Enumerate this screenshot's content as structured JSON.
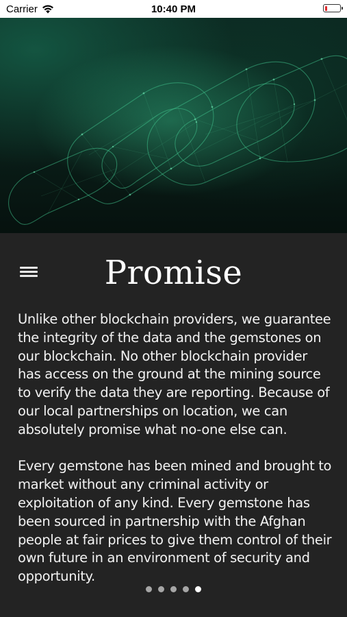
{
  "status_bar": {
    "carrier": "Carrier",
    "time": "10:40 PM",
    "battery_level": 0.1,
    "battery_color": "#e0292b"
  },
  "hero": {
    "image": "blockchain-chain-links",
    "tint_color": "#1a7a5c"
  },
  "menu": {
    "icon": "hamburger-menu-icon"
  },
  "page": {
    "title": "Promise",
    "paragraphs": [
      "Unlike other blockchain providers, we guarantee the integrity of the data and the gemstones on our blockchain. No other blockchain provider has access on the ground at the mining source to verify the data they are reporting. Because of our local partnerships on location, we can absolutely promise what no-one else can.",
      "Every gemstone has been mined and brought to market without any criminal activity or exploitation of any kind. Every gemstone has been sourced in partnership with the Afghan people at fair prices to give them control of their own future in an environment of security and opportunity."
    ]
  },
  "pagination": {
    "total": 5,
    "current": 5
  },
  "colors": {
    "background": "#232323",
    "text": "#f2f2f2",
    "dot_inactive": "#a6a6a6",
    "dot_active": "#ffffff"
  }
}
